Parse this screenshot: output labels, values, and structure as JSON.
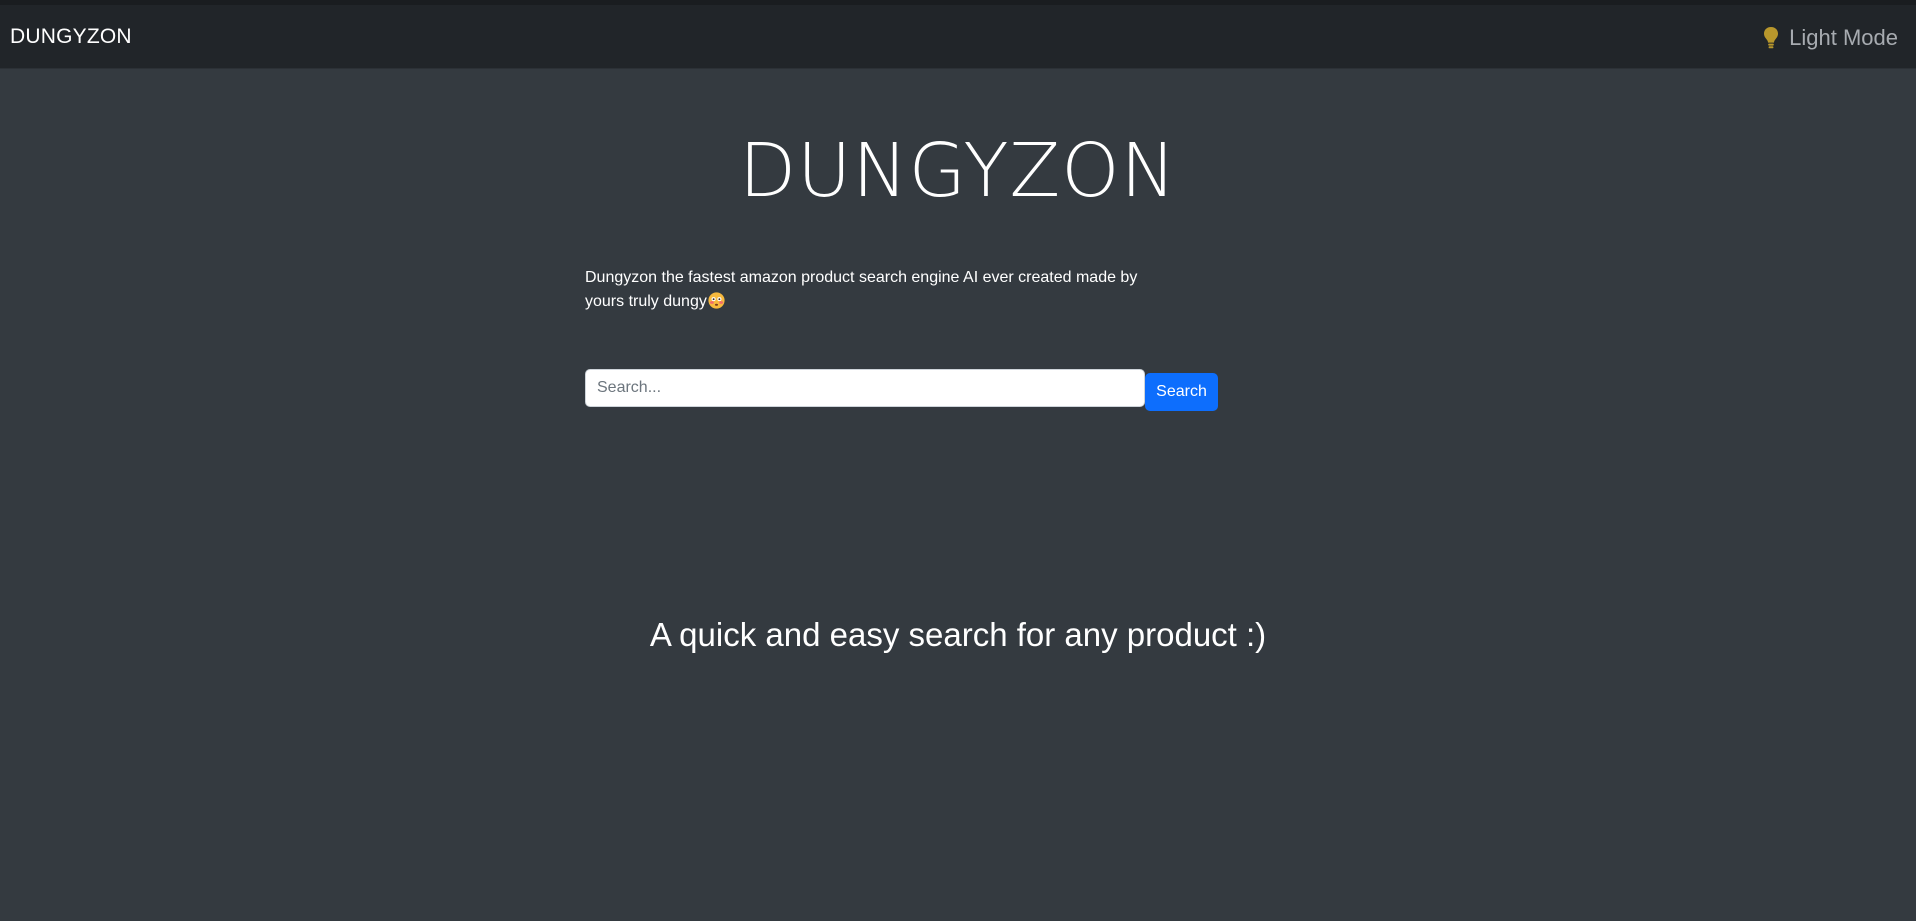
{
  "navbar": {
    "brand": "DUNGYZON",
    "mode_toggle_label": "Light Mode",
    "mode_toggle_icon": "lightbulb-icon"
  },
  "hero": {
    "title": "DUNGYZON",
    "description": "Dungyzon the fastest amazon product search engine AI ever created made by yours truly dungy",
    "description_emoji": "flushed-face-emoji"
  },
  "search": {
    "placeholder": "Search...",
    "value": "",
    "button_label": "Search"
  },
  "tagline": "A quick and easy search for any product :)",
  "colors": {
    "page_bg": "#343a40",
    "navbar_bg": "#212529",
    "button_bg": "#0d6efd",
    "toggle_text": "#a7abb0",
    "bulb": "#b8972c"
  }
}
